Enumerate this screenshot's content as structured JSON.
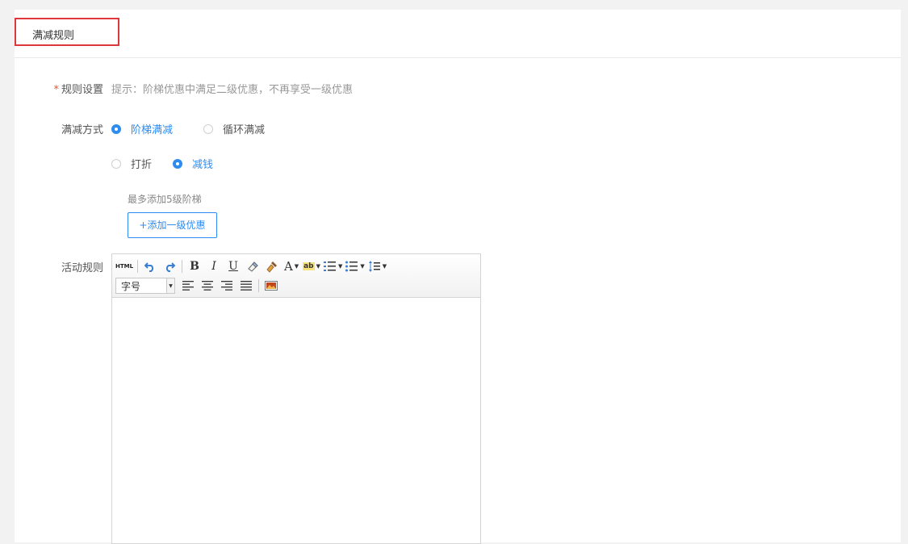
{
  "header": {
    "title": "满减规则"
  },
  "rule_setting": {
    "label": "规则设置",
    "required_mark": "*",
    "hint": "提示：阶梯优惠中满足二级优惠，不再享受一级优惠"
  },
  "discount_mode": {
    "label": "满减方式",
    "options_row1": [
      {
        "label": "阶梯满减",
        "checked": true
      },
      {
        "label": "循环满减",
        "checked": false
      }
    ],
    "options_row2": [
      {
        "label": "打折",
        "checked": false
      },
      {
        "label": "减钱",
        "checked": true
      }
    ],
    "note": "最多添加5级阶梯",
    "add_button": "+添加一级优惠"
  },
  "activity_rules": {
    "label": "活动规则",
    "editor": {
      "html_button": "HTML",
      "bold": "B",
      "italic": "I",
      "underline": "U",
      "font_color": "A",
      "highlight": "ab",
      "font_size_select": "字号",
      "content": ""
    }
  },
  "colors": {
    "accent": "#2d8cf0",
    "highlight_border": "#e0383a",
    "required": "#e8552b"
  }
}
